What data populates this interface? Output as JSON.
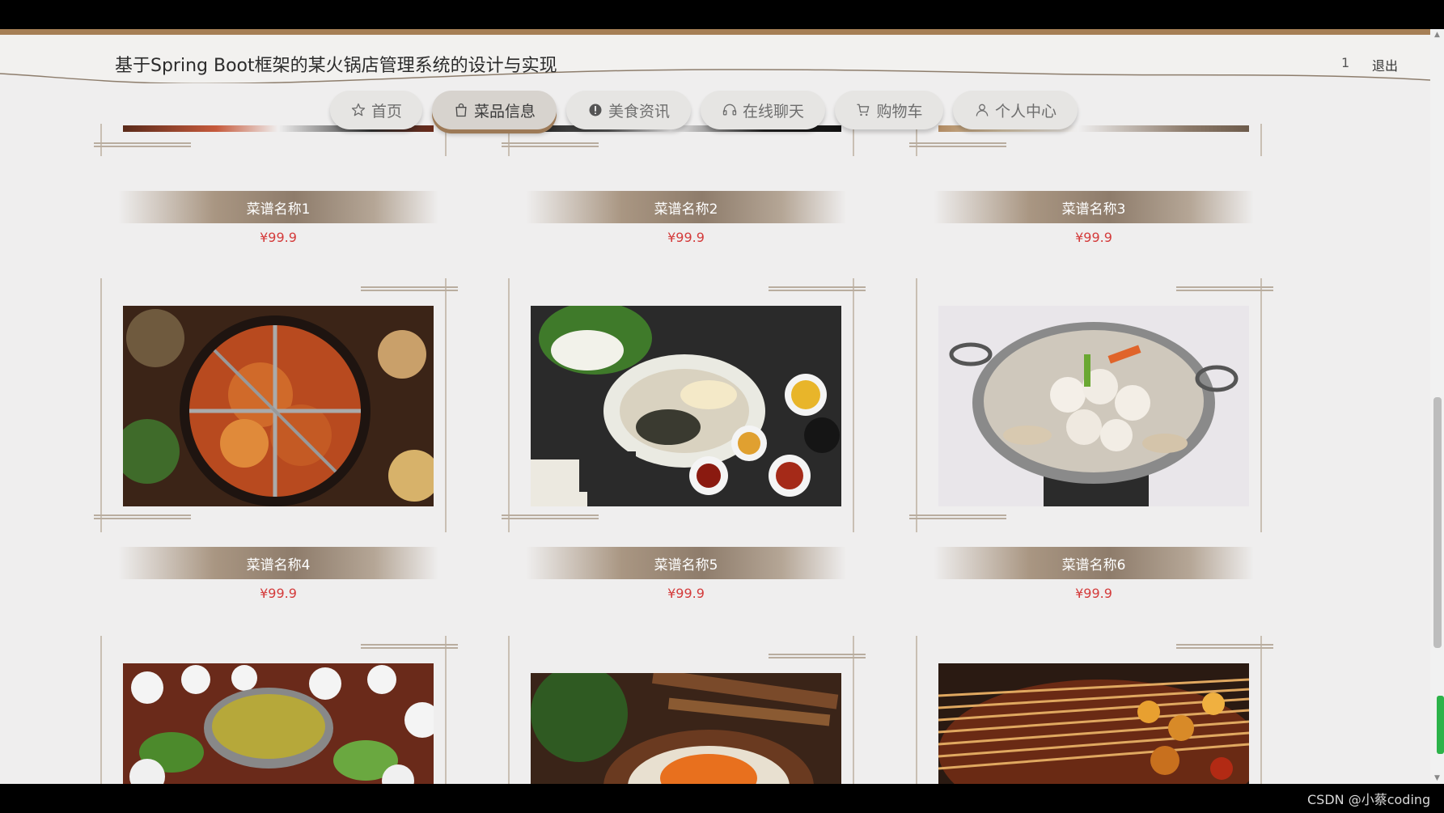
{
  "header": {
    "title": "基于Spring Boot框架的某火锅店管理系统的设计与实现",
    "user": "1",
    "logout": "退出"
  },
  "nav": [
    {
      "label": "首页",
      "icon": "star-icon",
      "active": false
    },
    {
      "label": "菜品信息",
      "icon": "shopping-bag-icon",
      "active": true
    },
    {
      "label": "美食资讯",
      "icon": "info-circle-icon",
      "active": false
    },
    {
      "label": "在线聊天",
      "icon": "headset-icon",
      "active": false
    },
    {
      "label": "购物车",
      "icon": "cart-icon",
      "active": false
    },
    {
      "label": "个人中心",
      "icon": "user-icon",
      "active": false
    }
  ],
  "dishes": [
    {
      "name": "菜谱名称1",
      "price": "¥99.9"
    },
    {
      "name": "菜谱名称2",
      "price": "¥99.9"
    },
    {
      "name": "菜谱名称3",
      "price": "¥99.9"
    },
    {
      "name": "菜谱名称4",
      "price": "¥99.9"
    },
    {
      "name": "菜谱名称5",
      "price": "¥99.9"
    },
    {
      "name": "菜谱名称6",
      "price": "¥99.9"
    },
    {
      "name": "",
      "price": ""
    },
    {
      "name": "",
      "price": ""
    },
    {
      "name": "",
      "price": ""
    }
  ],
  "watermark": "CSDN @小蔡coding",
  "colors": {
    "accent": "#a67f55",
    "price": "#d43b3b",
    "background": "#efeeee"
  }
}
